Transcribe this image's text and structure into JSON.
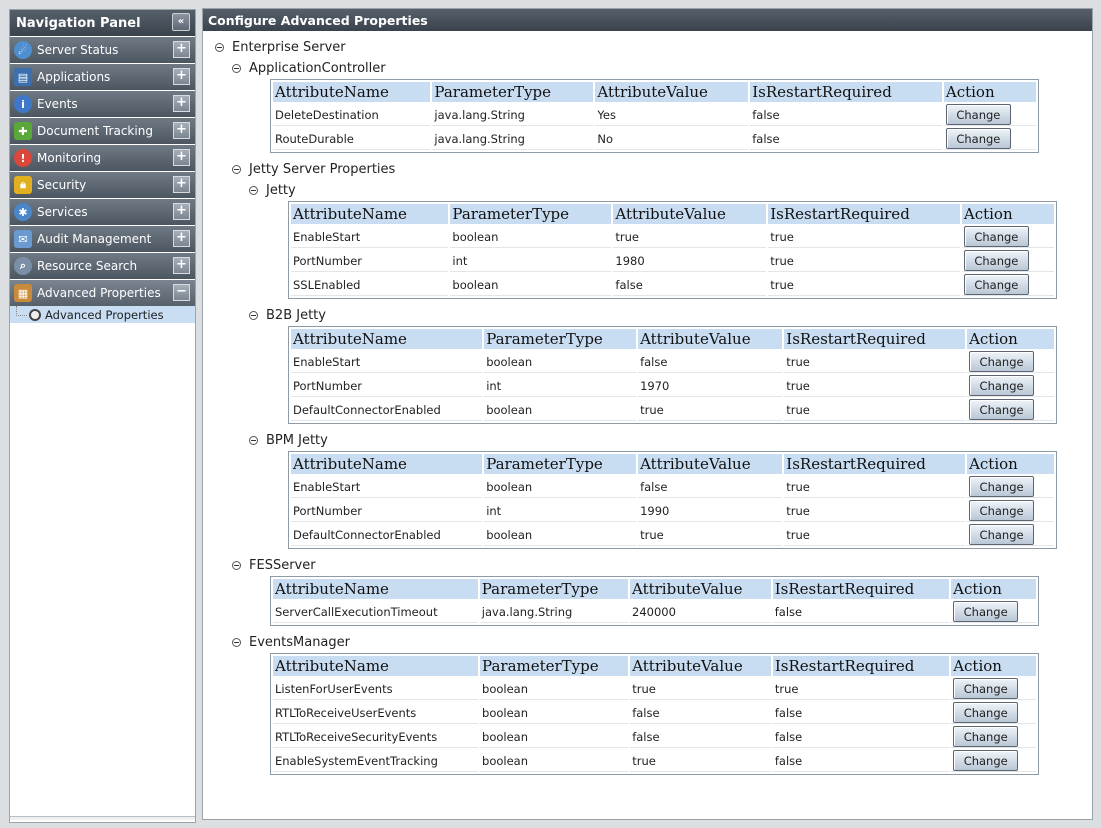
{
  "nav": {
    "title": "Navigation Panel",
    "items": [
      {
        "label": "Server Status",
        "icon": "server-status-icon"
      },
      {
        "label": "Applications",
        "icon": "applications-icon"
      },
      {
        "label": "Events",
        "icon": "events-icon"
      },
      {
        "label": "Document Tracking",
        "icon": "puzzle-icon"
      },
      {
        "label": "Monitoring",
        "icon": "monitoring-icon"
      },
      {
        "label": "Security",
        "icon": "lock-icon"
      },
      {
        "label": "Services",
        "icon": "services-icon"
      },
      {
        "label": "Audit Management",
        "icon": "audit-icon"
      },
      {
        "label": "Resource Search",
        "icon": "search-icon"
      },
      {
        "label": "Advanced Properties",
        "icon": "advanced-properties-icon"
      }
    ],
    "subitem": {
      "label": "Advanced Properties",
      "icon": "clock-icon"
    }
  },
  "main": {
    "title": "Configure Advanced Properties",
    "root": "Enterprise Server",
    "headers": [
      "AttributeName",
      "ParameterType",
      "AttributeValue",
      "IsRestartRequired",
      "Action"
    ],
    "change_label": "Change",
    "sections": {
      "app_controller": {
        "title": "ApplicationController",
        "rows": [
          [
            "DeleteDestination",
            "java.lang.String",
            "Yes",
            "false"
          ],
          [
            "RouteDurable",
            "java.lang.String",
            "No",
            "false"
          ]
        ]
      },
      "jetty_server": {
        "title": "Jetty Server Properties",
        "jetty": {
          "title": "Jetty",
          "rows": [
            [
              "EnableStart",
              "boolean",
              "true",
              "true"
            ],
            [
              "PortNumber",
              "int",
              "1980",
              "true"
            ],
            [
              "SSLEnabled",
              "boolean",
              "false",
              "true"
            ]
          ]
        },
        "b2b": {
          "title": "B2B Jetty",
          "rows": [
            [
              "EnableStart",
              "boolean",
              "false",
              "true"
            ],
            [
              "PortNumber",
              "int",
              "1970",
              "true"
            ],
            [
              "DefaultConnectorEnabled",
              "boolean",
              "true",
              "true"
            ]
          ]
        },
        "bpm": {
          "title": "BPM Jetty",
          "rows": [
            [
              "EnableStart",
              "boolean",
              "false",
              "true"
            ],
            [
              "PortNumber",
              "int",
              "1990",
              "true"
            ],
            [
              "DefaultConnectorEnabled",
              "boolean",
              "true",
              "true"
            ]
          ]
        }
      },
      "fes_server": {
        "title": "FESServer",
        "rows": [
          [
            "ServerCallExecutionTimeout",
            "java.lang.String",
            "240000",
            "false"
          ]
        ]
      },
      "events_manager": {
        "title": "EventsManager",
        "rows": [
          [
            "ListenForUserEvents",
            "boolean",
            "true",
            "true"
          ],
          [
            "RTLToReceiveUserEvents",
            "boolean",
            "false",
            "false"
          ],
          [
            "RTLToReceiveSecurityEvents",
            "boolean",
            "false",
            "false"
          ],
          [
            "EnableSystemEventTracking",
            "boolean",
            "true",
            "false"
          ]
        ]
      }
    }
  },
  "colors": {
    "header_bg": "#3a434c",
    "nav_item_bg": "#56606b",
    "table_header_bg": "#c9ddf2",
    "selected_bg": "#c9def3"
  }
}
